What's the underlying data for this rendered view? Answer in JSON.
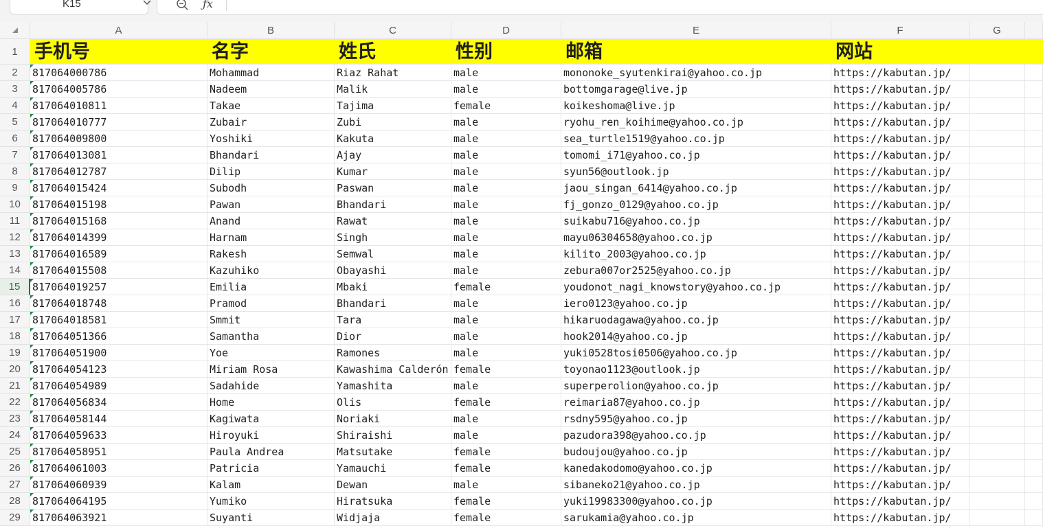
{
  "formula_bar": {
    "name_box": "K15",
    "fx_label": "ƒx",
    "formula": ""
  },
  "columns": [
    "A",
    "B",
    "C",
    "D",
    "E",
    "F",
    "G"
  ],
  "row_numbers": [
    "1",
    "2",
    "3",
    "4",
    "5",
    "6",
    "7",
    "8",
    "9",
    "10",
    "11",
    "12",
    "13",
    "14",
    "15",
    "16",
    "17",
    "18",
    "19",
    "20",
    "21",
    "22",
    "23",
    "24",
    "25",
    "26",
    "27",
    "28",
    "29"
  ],
  "active_row": "15",
  "header": [
    "手机号",
    "名字",
    "姓氏",
    "性别",
    "邮箱",
    "网站",
    ""
  ],
  "rows": [
    [
      "817064000786",
      "Mohammad",
      "Riaz Rahat",
      "male",
      "mononoke_syutenkirai@yahoo.co.jp",
      "https://kabutan.jp/",
      ""
    ],
    [
      "817064005786",
      "Nadeem",
      "Malik",
      "male",
      "bottomgarage@live.jp",
      "https://kabutan.jp/",
      ""
    ],
    [
      "817064010811",
      "Takae",
      "Tajima",
      "female",
      "koikeshoma@live.jp",
      "https://kabutan.jp/",
      ""
    ],
    [
      "817064010777",
      "Zubair",
      "Zubi",
      "male",
      "ryohu_ren_koihime@yahoo.co.jp",
      "https://kabutan.jp/",
      ""
    ],
    [
      "817064009800",
      "Yoshiki",
      "Kakuta",
      "male",
      "sea_turtle1519@yahoo.co.jp",
      "https://kabutan.jp/",
      ""
    ],
    [
      "817064013081",
      "Bhandari",
      "Ajay",
      "male",
      "tomomi_i71@yahoo.co.jp",
      "https://kabutan.jp/",
      ""
    ],
    [
      "817064012787",
      "Dilip",
      "Kumar",
      "male",
      "syun56@outlook.jp",
      "https://kabutan.jp/",
      ""
    ],
    [
      "817064015424",
      "Subodh",
      "Paswan",
      "male",
      "jaou_singan_6414@yahoo.co.jp",
      "https://kabutan.jp/",
      ""
    ],
    [
      "817064015198",
      "Pawan",
      "Bhandari",
      "male",
      "fj_gonzo_0129@yahoo.co.jp",
      "https://kabutan.jp/",
      ""
    ],
    [
      "817064015168",
      "Anand",
      "Rawat",
      "male",
      "suikabu716@yahoo.co.jp",
      "https://kabutan.jp/",
      ""
    ],
    [
      "817064014399",
      "Harnam",
      "Singh",
      "male",
      "mayu06304658@yahoo.co.jp",
      "https://kabutan.jp/",
      ""
    ],
    [
      "817064016589",
      "Rakesh",
      "Semwal",
      "male",
      "kilito_2003@yahoo.co.jp",
      "https://kabutan.jp/",
      ""
    ],
    [
      "817064015508",
      "Kazuhiko",
      "Obayashi",
      "male",
      "zebura007or2525@yahoo.co.jp",
      "https://kabutan.jp/",
      ""
    ],
    [
      "817064019257",
      "Emilia",
      "Mbaki",
      "female",
      "youdonot_nagi_knowstory@yahoo.co.jp",
      "https://kabutan.jp/",
      ""
    ],
    [
      "817064018748",
      "Pramod",
      "Bhandari",
      "male",
      "iero0123@yahoo.co.jp",
      "https://kabutan.jp/",
      ""
    ],
    [
      "817064018581",
      "Smmit",
      "Tara",
      "male",
      "hikaruodagawa@yahoo.co.jp",
      "https://kabutan.jp/",
      ""
    ],
    [
      "817064051366",
      "Samantha",
      "Dior",
      "male",
      "hook2014@yahoo.co.jp",
      "https://kabutan.jp/",
      ""
    ],
    [
      "817064051900",
      "Yoe",
      "Ramones",
      "male",
      "yuki0528tosi0506@yahoo.co.jp",
      "https://kabutan.jp/",
      ""
    ],
    [
      "817064054123",
      "Miriam Rosa",
      "Kawashima Calderón",
      "female",
      "toyonao1123@outlook.jp",
      "https://kabutan.jp/",
      ""
    ],
    [
      "817064054989",
      "Sadahide",
      "Yamashita",
      "male",
      "superperolion@yahoo.co.jp",
      "https://kabutan.jp/",
      ""
    ],
    [
      "817064056834",
      "Home",
      "Olis",
      "female",
      "reimaria87@yahoo.co.jp",
      "https://kabutan.jp/",
      ""
    ],
    [
      "817064058144",
      "Kagiwata",
      "Noriaki",
      "male",
      "rsdny595@yahoo.co.jp",
      "https://kabutan.jp/",
      ""
    ],
    [
      "817064059633",
      "Hiroyuki",
      "Shiraishi",
      "male",
      "pazudora398@yahoo.co.jp",
      "https://kabutan.jp/",
      ""
    ],
    [
      "817064058951",
      "Paula Andrea",
      "Matsutake",
      "female",
      "budoujou@yahoo.co.jp",
      "https://kabutan.jp/",
      ""
    ],
    [
      "817064061003",
      "Patricia",
      "Yamauchi",
      "female",
      "kanedakodomo@yahoo.co.jp",
      "https://kabutan.jp/",
      ""
    ],
    [
      "817064060939",
      "Kalam",
      "Dewan",
      "male",
      "sibaneko21@yahoo.co.jp",
      "https://kabutan.jp/",
      ""
    ],
    [
      "817064064195",
      "Yumiko",
      "Hiratsuka",
      "female",
      "yuki19983300@yahoo.co.jp",
      "https://kabutan.jp/",
      ""
    ],
    [
      "817064063921",
      "Suyanti",
      "Widjaja",
      "female",
      "sarukamia@yahoo.co.jp",
      "https://kabutan.jp/",
      ""
    ]
  ]
}
